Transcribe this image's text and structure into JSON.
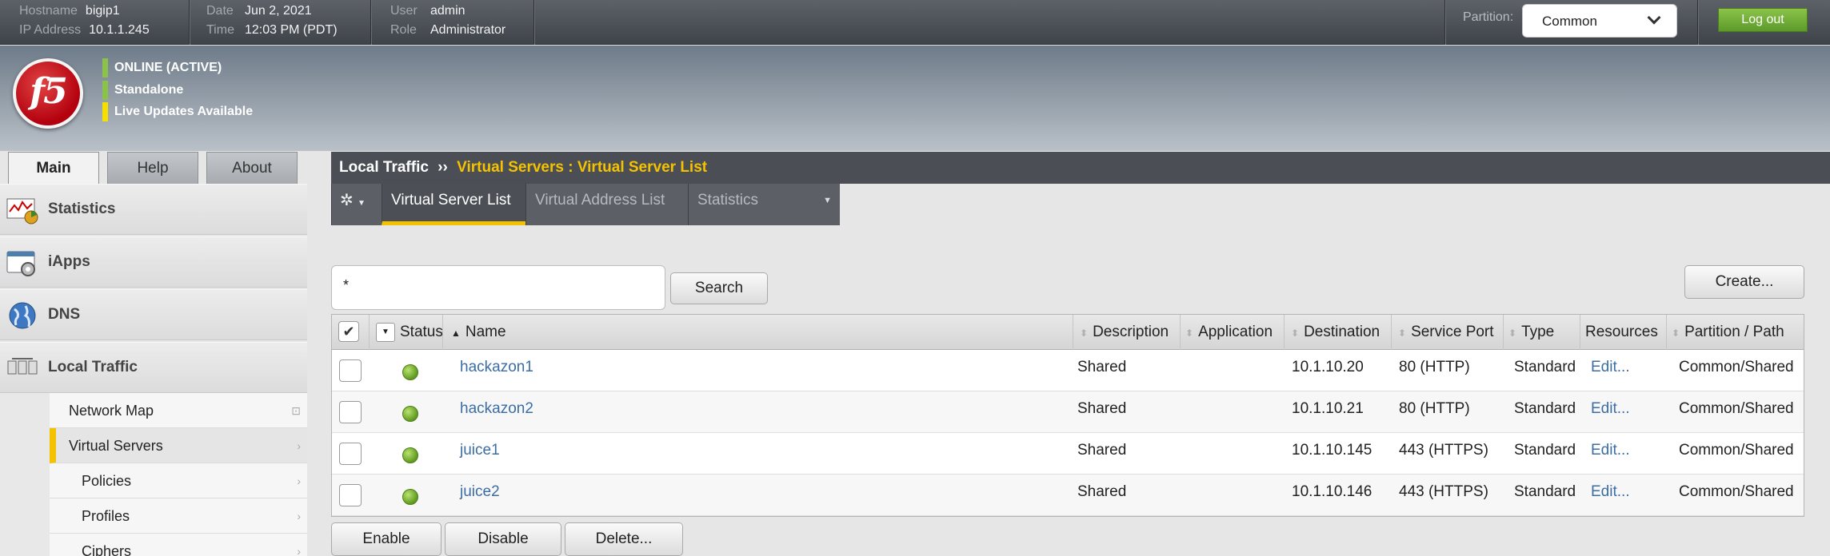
{
  "topbar": {
    "hostname_label": "Hostname",
    "hostname": "bigip1",
    "ip_label": "IP Address",
    "ip": "10.1.1.245",
    "date_label": "Date",
    "date": "Jun 2, 2021",
    "time_label": "Time",
    "time": "12:03 PM (PDT)",
    "user_label": "User",
    "user": "admin",
    "role_label": "Role",
    "role": "Administrator",
    "partition_label": "Partition:",
    "partition_value": "Common",
    "logout_label": "Log out"
  },
  "banner": {
    "logo_text": "f5",
    "status": [
      "ONLINE (ACTIVE)",
      "Standalone",
      "Live Updates Available"
    ]
  },
  "tabs": [
    "Main",
    "Help",
    "About"
  ],
  "sidebar": {
    "sections": [
      "Statistics",
      "iApps",
      "DNS",
      "Local Traffic"
    ],
    "submenu": [
      "Network Map",
      "Virtual Servers",
      "Policies",
      "Profiles",
      "Ciphers"
    ]
  },
  "breadcrumb": {
    "section": "Local Traffic",
    "separator": "››",
    "current": "Virtual Servers : Virtual Server List"
  },
  "subnav": {
    "items": [
      "Virtual Server List",
      "Virtual Address List",
      "Statistics"
    ]
  },
  "search": {
    "value": "*",
    "button": "Search"
  },
  "create_label": "Create...",
  "table": {
    "headers": [
      "Status",
      "Name",
      "Description",
      "Application",
      "Destination",
      "Service Port",
      "Type",
      "Resources",
      "Partition / Path"
    ],
    "rows": [
      {
        "name": "hackazon1",
        "description": "Shared",
        "application": "",
        "destination": "10.1.10.20",
        "service_port": "80 (HTTP)",
        "type": "Standard",
        "resources": "Edit...",
        "partition": "Common/Shared"
      },
      {
        "name": "hackazon2",
        "description": "Shared",
        "application": "",
        "destination": "10.1.10.21",
        "service_port": "80 (HTTP)",
        "type": "Standard",
        "resources": "Edit...",
        "partition": "Common/Shared"
      },
      {
        "name": "juice1",
        "description": "Shared",
        "application": "",
        "destination": "10.1.10.145",
        "service_port": "443 (HTTPS)",
        "type": "Standard",
        "resources": "Edit...",
        "partition": "Common/Shared"
      },
      {
        "name": "juice2",
        "description": "Shared",
        "application": "",
        "destination": "10.1.10.146",
        "service_port": "443 (HTTPS)",
        "type": "Standard",
        "resources": "Edit...",
        "partition": "Common/Shared"
      }
    ]
  },
  "actions": [
    "Enable",
    "Disable",
    "Delete..."
  ],
  "colors": {
    "accent": "#f5c200",
    "online": "#8bc34a",
    "link": "#3b6ea5"
  }
}
